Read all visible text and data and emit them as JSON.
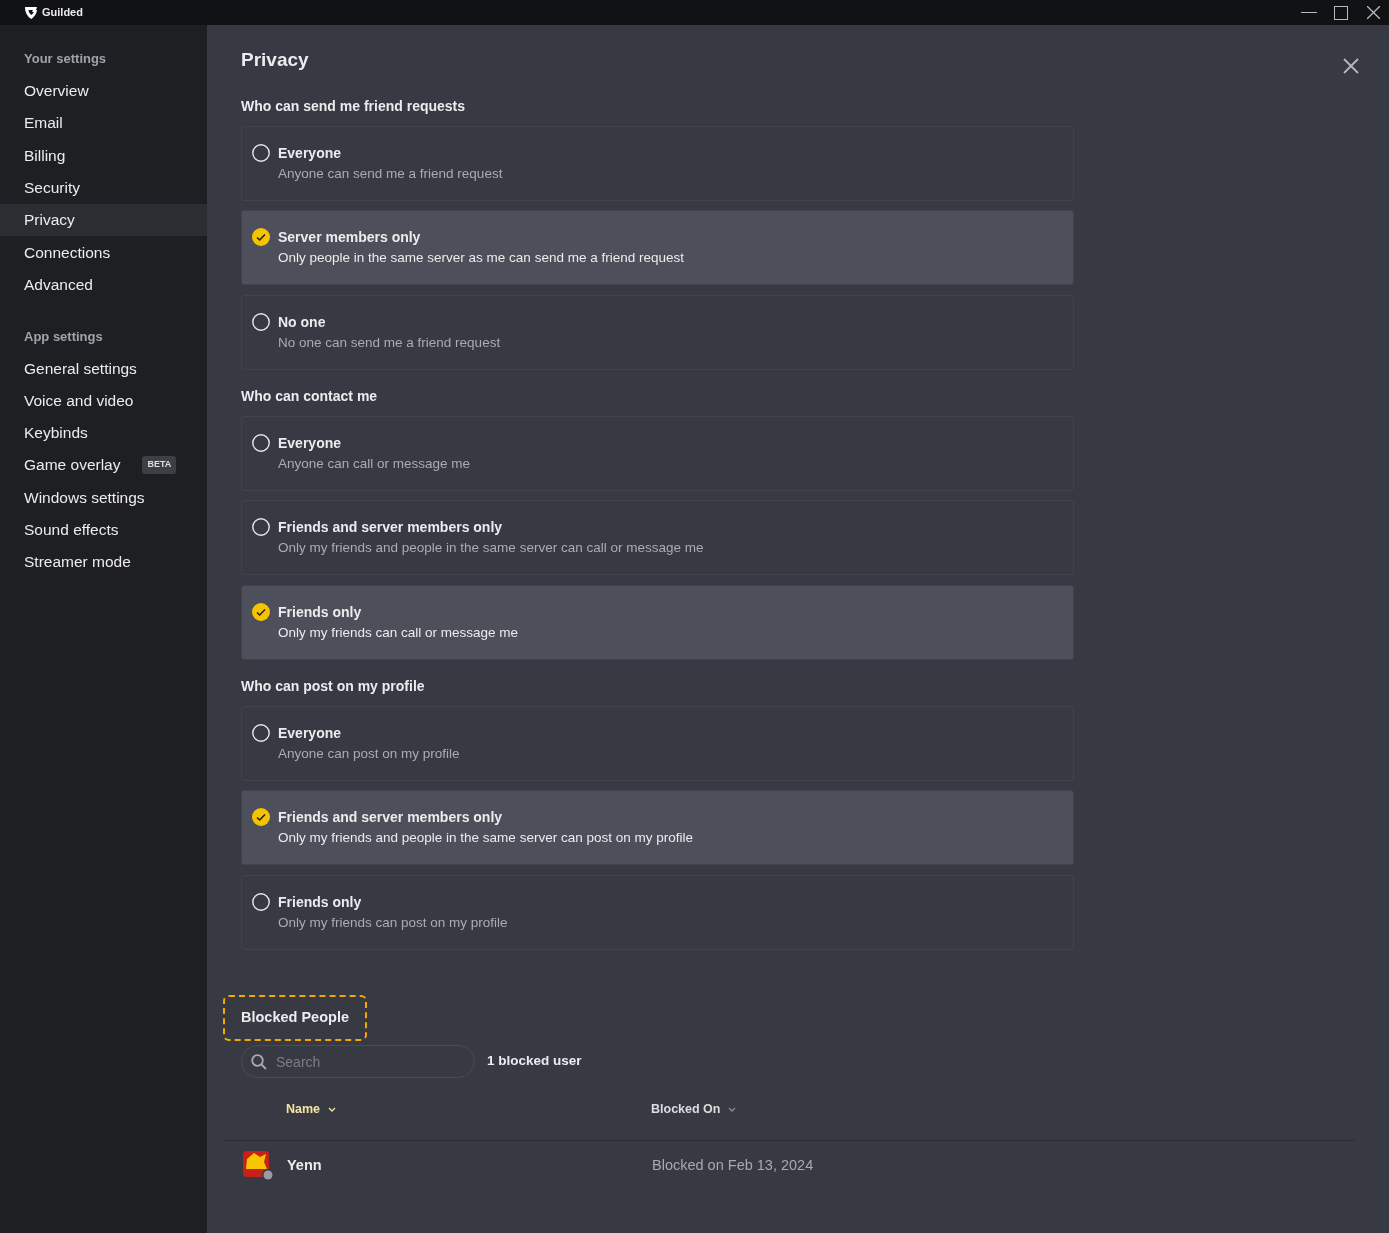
{
  "window": {
    "title": "Guilded"
  },
  "sidebar": {
    "sections": [
      {
        "heading": "Your settings",
        "items": [
          {
            "label": "Overview",
            "selected": false
          },
          {
            "label": "Email",
            "selected": false
          },
          {
            "label": "Billing",
            "selected": false
          },
          {
            "label": "Security",
            "selected": false
          },
          {
            "label": "Privacy",
            "selected": true
          },
          {
            "label": "Connections",
            "selected": false
          },
          {
            "label": "Advanced",
            "selected": false
          }
        ]
      },
      {
        "heading": "App settings",
        "items": [
          {
            "label": "General settings",
            "selected": false
          },
          {
            "label": "Voice and video",
            "selected": false
          },
          {
            "label": "Keybinds",
            "selected": false
          },
          {
            "label": "Game overlay",
            "selected": false,
            "badge": "BETA"
          },
          {
            "label": "Windows settings",
            "selected": false
          },
          {
            "label": "Sound effects",
            "selected": false
          },
          {
            "label": "Streamer mode",
            "selected": false
          }
        ]
      }
    ]
  },
  "page": {
    "title": "Privacy",
    "groups": [
      {
        "heading": "Who can send me friend requests",
        "options": [
          {
            "title": "Everyone",
            "description": "Anyone can send me a friend request",
            "selected": false
          },
          {
            "title": "Server members only",
            "description": "Only people in the same server as me can send me a friend request",
            "selected": true
          },
          {
            "title": "No one",
            "description": "No one can send me a friend request",
            "selected": false
          }
        ]
      },
      {
        "heading": "Who can contact me",
        "options": [
          {
            "title": "Everyone",
            "description": "Anyone can call or message me",
            "selected": false
          },
          {
            "title": "Friends and server members only",
            "description": "Only my friends and people in the same server can call or message me",
            "selected": false
          },
          {
            "title": "Friends only",
            "description": "Only my friends can call or message me",
            "selected": true
          }
        ]
      },
      {
        "heading": "Who can post on my profile",
        "options": [
          {
            "title": "Everyone",
            "description": "Anyone can post on my profile",
            "selected": false
          },
          {
            "title": "Friends and server members only",
            "description": "Only my friends and people in the same server can post on my profile",
            "selected": true
          },
          {
            "title": "Friends only",
            "description": "Only my friends can post on my profile",
            "selected": false
          }
        ]
      }
    ]
  },
  "blocked": {
    "heading": "Blocked People",
    "highlighted": true,
    "search": {
      "placeholder": "Search"
    },
    "count": "1 blocked user",
    "columns": [
      {
        "label": "Name",
        "selected": true
      },
      {
        "label": "Blocked On",
        "selected": false
      }
    ],
    "rows": [
      {
        "name": "Yenn",
        "blocked_on": "Blocked on Feb 13, 2024"
      }
    ]
  }
}
